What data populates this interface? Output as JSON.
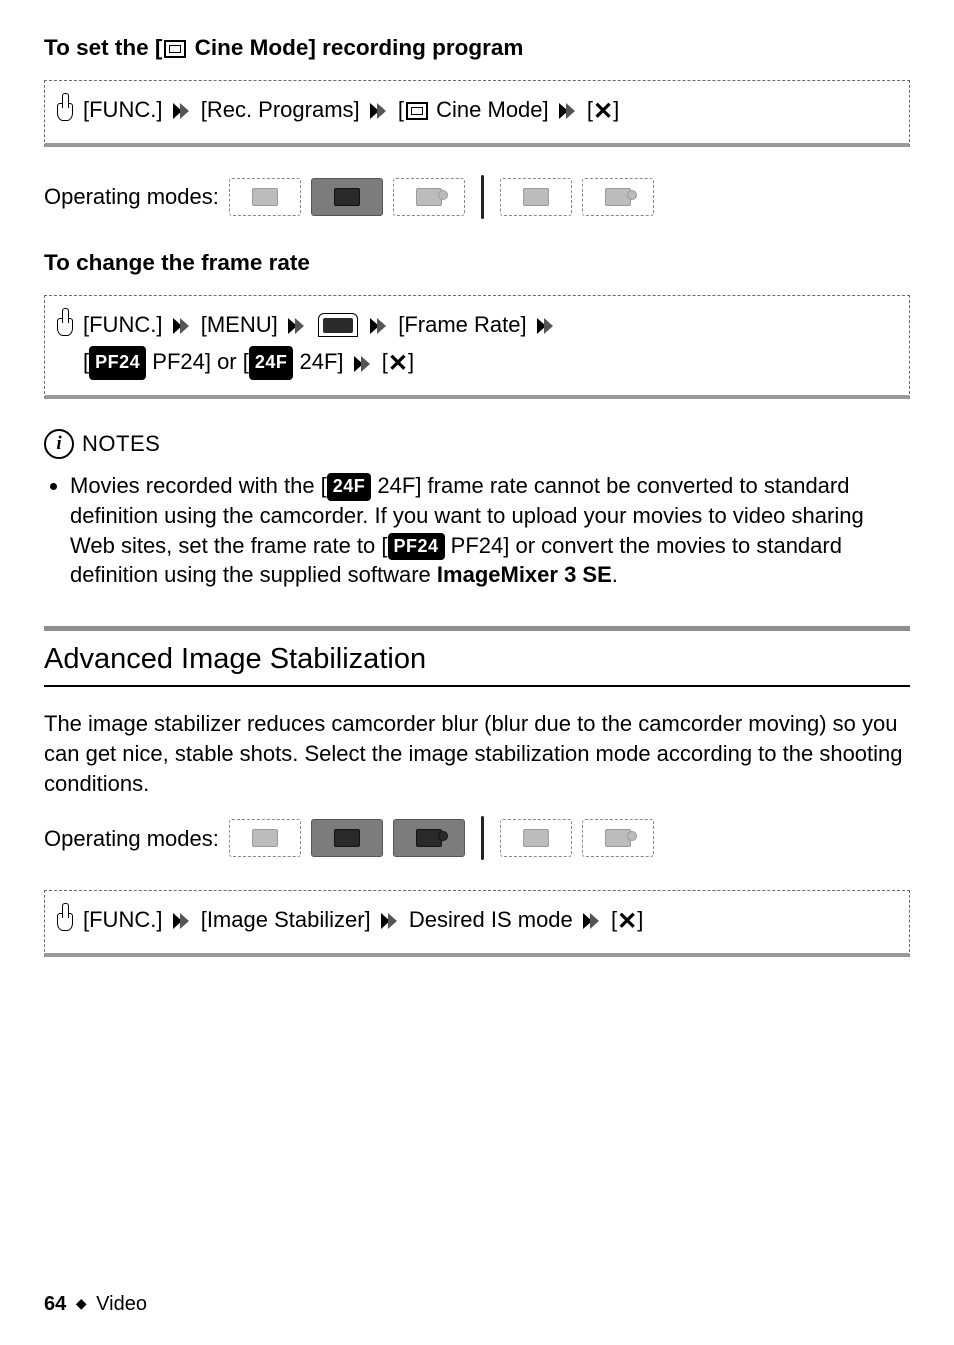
{
  "headings": {
    "set_cine_pre": "To set the [",
    "set_cine_post": " Cine Mode] recording program",
    "change_frame": "To change the frame rate"
  },
  "nav1": {
    "func": "[FUNC.]",
    "rec_programs": "[Rec. Programs]",
    "cine_pre": "[",
    "cine_post": " Cine Mode]",
    "close": "[✕]"
  },
  "operating_modes_label": "Operating modes:",
  "nav2": {
    "func": "[FUNC.]",
    "menu": "[MENU]",
    "frame_rate": "[Frame Rate]",
    "opt1_pre": "[",
    "opt1_pill": "PF24",
    "opt1_post": " PF24] or [",
    "opt2_pill": "24F",
    "opt2_post": " 24F]",
    "close": "[✕]"
  },
  "notes": {
    "label": "NOTES",
    "bullet_pre": "Movies recorded with the [",
    "bullet_pill1": "24F",
    "bullet_mid1": " 24F] frame rate cannot be converted to standard definition using the camcorder. If you want to upload your movies to video sharing Web sites, set the frame rate to [",
    "bullet_pill2": "PF24",
    "bullet_mid2": " PF24] or convert the movies to standard definition using the supplied software ",
    "bullet_bold": "ImageMixer 3 SE",
    "bullet_end": "."
  },
  "section2": {
    "title": "Advanced Image Stabilization",
    "body": "The image stabilizer reduces camcorder blur (blur due to the camcorder moving) so you can get nice, stable shots. Select the image stabilization mode according to the shooting conditions."
  },
  "nav3": {
    "func": "[FUNC.]",
    "img_stab": "[Image Stabilizer]",
    "desired": "Desired IS mode",
    "close": "[✕]"
  },
  "footer": {
    "page": "64",
    "section": "Video"
  }
}
